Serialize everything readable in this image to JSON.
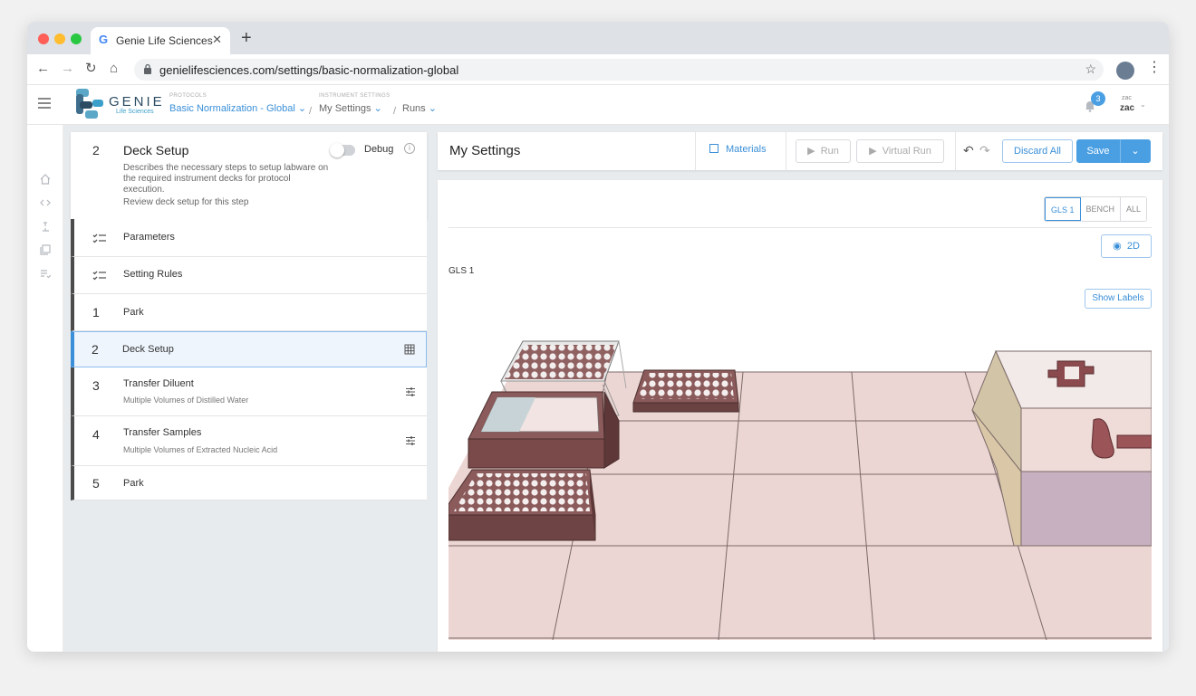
{
  "browser": {
    "tab_title": "Genie Life Sciences",
    "url": "genielifesciences.com/settings/basic-normalization-global"
  },
  "header": {
    "brand": "GENIE",
    "brand_sub": "Life Sciences",
    "breadcrumbs": [
      {
        "caption": "PROTOCOLS",
        "value": "Basic Normalization - Global"
      },
      {
        "caption": "INSTRUMENT SETTINGS",
        "value": "My Settings"
      },
      {
        "caption": "",
        "value": "Runs"
      }
    ],
    "notifications": "3",
    "user_small": "zac",
    "user": "zac"
  },
  "step_panel": {
    "current_number": "2",
    "current_title": "Deck Setup",
    "description": "Describes the necessary steps to setup labware on the required instrument decks for protocol execution.",
    "review": "Review deck setup for this step",
    "debug_label": "Debug",
    "items": [
      {
        "number": "",
        "label": "Parameters",
        "sub": ""
      },
      {
        "number": "",
        "label": "Setting Rules",
        "sub": ""
      },
      {
        "number": "1",
        "label": "Park",
        "sub": ""
      },
      {
        "number": "2",
        "label": "Deck Setup",
        "sub": ""
      },
      {
        "number": "3",
        "label": "Transfer Diluent",
        "sub": "Multiple Volumes of Distilled Water"
      },
      {
        "number": "4",
        "label": "Transfer Samples",
        "sub": "Multiple Volumes of Extracted Nucleic Acid"
      },
      {
        "number": "5",
        "label": "Park",
        "sub": ""
      }
    ]
  },
  "main": {
    "title": "My Settings",
    "materials": "Materials",
    "run": "Run",
    "virtual_run": "Virtual Run",
    "discard": "Discard All",
    "save": "Save",
    "deck_tabs": [
      "GLS 1",
      "BENCH",
      "ALL"
    ],
    "view_mode": "2D",
    "deck_label": "GLS 1",
    "show_labels": "Show Labels"
  },
  "colors": {
    "accent": "#3a8fd8",
    "labware": "#8b5a5a",
    "deck_tile": "#ecd6d3"
  }
}
